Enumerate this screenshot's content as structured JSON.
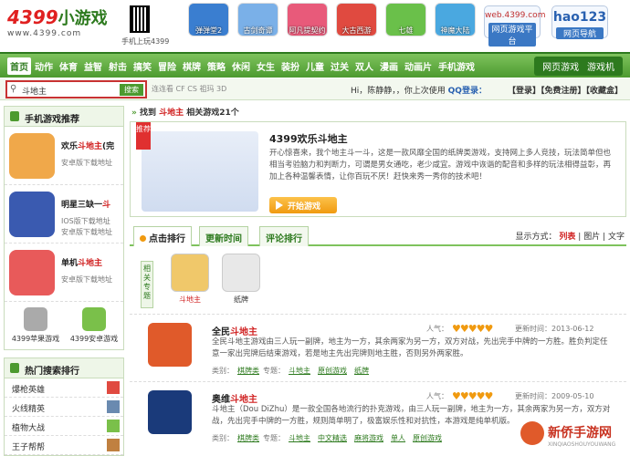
{
  "header": {
    "logo_num": "4399",
    "logo_cn": "小游戏",
    "logo_url": "www.4399.com",
    "qr_label": "手机上玩4399",
    "games": [
      {
        "label": "弹弹堂2",
        "color": "#3a7ed0"
      },
      {
        "label": "古剑奇谭",
        "color": "#7ab0e8"
      },
      {
        "label": "阿凡提契约",
        "color": "#e85a7a"
      },
      {
        "label": "大古西游",
        "color": "#e04a40"
      },
      {
        "label": "七雄",
        "color": "#6ac04a"
      },
      {
        "label": "神魔大陆",
        "color": "#4aa8e0"
      }
    ],
    "site_web": "web.4399.com",
    "site_web_sub": "网页游戏平台",
    "site_hao": "hao123",
    "site_hao_sub": "网页导航"
  },
  "nav": {
    "items": [
      "首页",
      "动作",
      "体育",
      "益智",
      "射击",
      "搞笑",
      "冒险",
      "棋牌",
      "策略",
      "休闲",
      "女生",
      "装扮",
      "儿童",
      "过关",
      "双人",
      "漫画",
      "动画片",
      "手机游戏"
    ],
    "hot1": "热门",
    "hot2": "最新",
    "right": [
      "网页游戏",
      "游戏机"
    ]
  },
  "search": {
    "value": "斗地主",
    "button": "搜索",
    "keywords": "连连看 CF CS 祖玛 3D"
  },
  "user": {
    "greeting": "Hi，陈静静，，你上次使用",
    "qq": "QQ登录：",
    "links": "【登录】【免费注册】【收藏盒】"
  },
  "sidebar": {
    "mobile_title": "手机游戏推荐",
    "mobile_games": [
      {
        "name_pre": "欢乐",
        "name_key": "斗地主",
        "name_post": "(完",
        "desc1": "安卓版下载地址",
        "desc2": "",
        "color": "#f0a84a"
      },
      {
        "name_pre": "明星三缺一",
        "name_key": "斗",
        "name_post": "",
        "desc1": "IOS版下载地址",
        "desc2": "安卓版下载地址",
        "color": "#3a5ab0"
      },
      {
        "name_pre": "单机",
        "name_key": "斗地主",
        "name_post": "",
        "desc1": "安卓版下载地址",
        "desc2": "",
        "color": "#e85a5a"
      }
    ],
    "apple_label": "4399苹果游戏",
    "android_label": "4399安卓游戏",
    "hot_title": "热门搜索排行",
    "hot_items": [
      "爆枪英雄",
      "火线精英",
      "植物大战",
      "王子帮帮"
    ]
  },
  "main": {
    "crumb_found": "找到",
    "crumb_key": "斗地主",
    "crumb_count": "相关游戏21个",
    "featured": {
      "ribbon": "推荐",
      "title": "4399欢乐斗地主",
      "desc": "开心惊喜来，我个地主斗一斗，这是一款风靡全国的纸牌类游戏，支持网上多人竞技，玩法简单但也相当考验脑力和判断力，可谓是男女通吃，老少咸宜。游戏中诙谐的配音和多样的玩法相得益彰，再加上各种温馨表情，让你百玩不厌！赶快来秀一秀你的技术吧！",
      "play": "开始游戏"
    },
    "tabs": [
      "点击排行",
      "更新时间",
      "评论排行"
    ],
    "view_label": "显示方式：",
    "view_list": "列表",
    "view_pic": "图片",
    "view_text": "文字",
    "related_label": "相关专题",
    "related": [
      {
        "name": "斗地主",
        "red": true
      },
      {
        "name": "纸牌",
        "red": false
      }
    ],
    "results": [
      {
        "name_pre": "全民",
        "name_key": "斗地主",
        "pop_label": "人气：",
        "hearts": "♥♥♥♥♥",
        "date": "更新时间：2013-06-12",
        "desc": "全民斗地主游戏由三人玩一副牌，地主为一方，其余两家为另一方，双方对战，先出完手中牌的一方胜。胜负判定任意一家出完牌后结束游戏，若是地主先出完牌则地主胜，否则另外两家胜。",
        "type_label": "类别：",
        "type": "棋牌类",
        "topic_label": "专题：",
        "topics": [
          "斗地主",
          "原创游戏",
          "纸牌"
        ],
        "color": "#e05a2a"
      },
      {
        "name_pre": "奥维",
        "name_key": "斗地主",
        "pop_label": "人气：",
        "hearts": "♥♥♥♥♥",
        "date": "更新时间：2009-05-10",
        "desc": "斗地主（Dou DiZhu）是一款全国各地流行的扑克游戏，由三人玩一副牌，地主为一方，其余两家为另一方，双方对战，先出完手中牌的一方胜，规则简单明了，极富娱乐性和对抗性，本游戏是纯单机版。",
        "type_label": "类别：",
        "type": "棋牌类",
        "topic_label": "专题：",
        "topics": [
          "斗地主",
          "中文精选",
          "麻将游戏",
          "单人",
          "原创游戏"
        ],
        "color": "#1a3a7a"
      }
    ]
  },
  "watermark": {
    "title": "新侨手游网",
    "sub": "XINQIAOSHOUYOUWANG"
  }
}
